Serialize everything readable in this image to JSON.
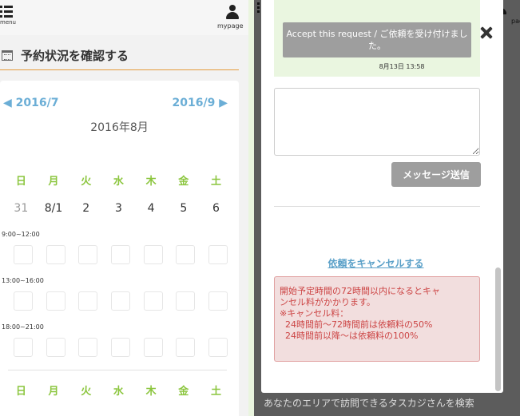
{
  "left": {
    "menu_label": "menu",
    "mypage_label": "mypage",
    "section_title": "予約状況を確認する",
    "calendar": {
      "prev_label": "◀ 2016/7",
      "next_label": "2016/9 ▶",
      "month_title": "2016年8月",
      "weekdays": [
        "日",
        "月",
        "火",
        "水",
        "木",
        "金",
        "土"
      ],
      "dates": [
        "31",
        "8/1",
        "2",
        "3",
        "4",
        "5",
        "6"
      ],
      "time_slots": [
        "9:00~12:00",
        "13:00~16:00",
        "18:00~21:00"
      ]
    }
  },
  "right": {
    "mypage_label": "page",
    "background_text": "あなたのエリアで訪問できるタスカジさんを検索"
  },
  "modal": {
    "tooltip_text": "Accept this request / ご依頼を受け付けました。",
    "message_time": "8月13日 13:58",
    "textarea_value": "",
    "textarea_placeholder": "",
    "send_button": "メッセージ送信",
    "cancel_link": "依頼をキャンセルする",
    "warning_lines": [
      "開始予定時間の72時間以内になるとキャ",
      "ンセル料がかかります。",
      "※キャンセル料：",
      "  24時間前〜72時間前は依頼料の50%",
      "  24時間前以降〜は依頼料の100%"
    ]
  },
  "colors": {
    "accent_orange": "#e59b3c",
    "weekday_green": "#8cc63f",
    "link_blue": "#6baed6",
    "warning_red": "#c44444",
    "warning_bg": "#f2dede",
    "message_bg": "#eaf6e0"
  },
  "icons": [
    "menu-icon",
    "user-icon",
    "calendar-icon",
    "close-icon",
    "resize-grip-icon"
  ]
}
